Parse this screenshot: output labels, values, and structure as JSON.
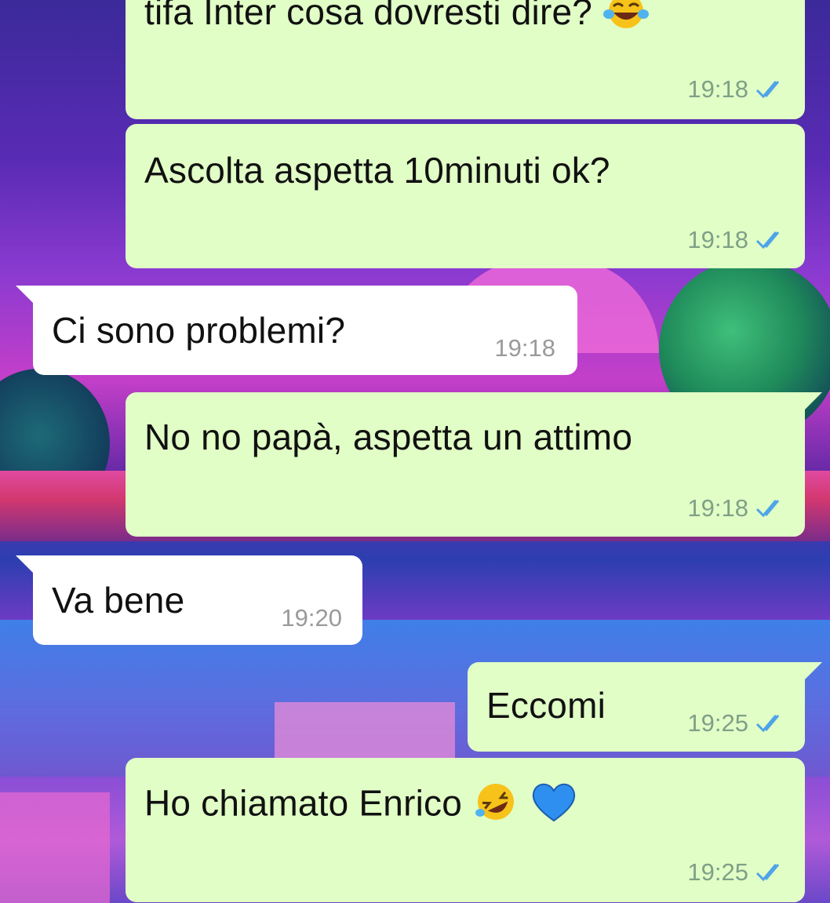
{
  "chat": {
    "messages": [
      {
        "text": "tifa Inter cosa dovresti dire?",
        "emoji": "laughing-crying-face",
        "time": "19:18",
        "status": "read",
        "direction": "outgoing"
      },
      {
        "text": "Ascolta aspetta 10minuti ok?",
        "time": "19:18",
        "status": "read",
        "direction": "outgoing"
      },
      {
        "text": "Ci sono problemi?",
        "time": "19:18",
        "direction": "incoming"
      },
      {
        "text": "No no papà, aspetta un attimo",
        "time": "19:18",
        "status": "read",
        "direction": "outgoing"
      },
      {
        "text": "Va bene",
        "time": "19:20",
        "direction": "incoming"
      },
      {
        "text": "Eccomi",
        "time": "19:25",
        "status": "read",
        "direction": "outgoing"
      },
      {
        "text": "Ho chiamato Enrico",
        "emoji": "rolling-laughing-face blue-heart",
        "time": "19:25",
        "status": "read",
        "direction": "outgoing"
      }
    ]
  },
  "colors": {
    "outgoing_bubble": "#e1fec6",
    "incoming_bubble": "#ffffff",
    "read_ticks": "#4fa3e8"
  }
}
